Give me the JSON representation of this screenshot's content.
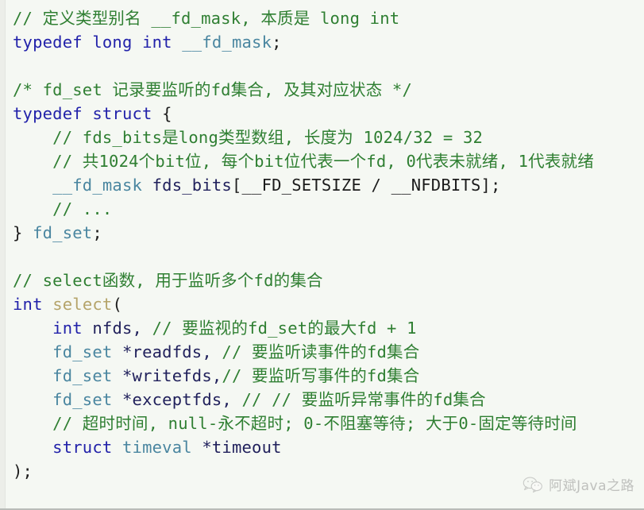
{
  "theme": {
    "background": "#f5f8f3",
    "gutter": "#eceee9",
    "comment_color": "#2f7f32",
    "keyword_color": "#2222aa",
    "type_color": "#4a86a0",
    "function_color": "#b5a46a",
    "identifier_color": "#21215c",
    "punctuation_color": "#1c1c1c"
  },
  "code": {
    "language": "c",
    "lines": [
      {
        "id": "l1",
        "text": "// 定义类型别名 __fd_mask, 本质是 long int"
      },
      {
        "id": "l2a",
        "text": "typedef"
      },
      {
        "id": "l2b",
        "text": "long"
      },
      {
        "id": "l2c",
        "text": "int"
      },
      {
        "id": "l2d",
        "text": "__fd_mask"
      },
      {
        "id": "l2e",
        "text": ";"
      },
      {
        "id": "l4",
        "text": "/* fd_set 记录要监听的fd集合, 及其对应状态 */"
      },
      {
        "id": "l5a",
        "text": "typedef"
      },
      {
        "id": "l5b",
        "text": "struct"
      },
      {
        "id": "l5c",
        "text": "{"
      },
      {
        "id": "l6",
        "text": "// fds_bits是long类型数组, 长度为 1024/32 = 32"
      },
      {
        "id": "l7",
        "text": "// 共1024个bit位, 每个bit位代表一个fd, 0代表未就绪, 1代表就绪"
      },
      {
        "id": "l8a",
        "text": "__fd_mask"
      },
      {
        "id": "l8b",
        "text": "fds_bits"
      },
      {
        "id": "l8c",
        "text": "[__FD_SETSIZE / __NFDBITS];"
      },
      {
        "id": "l9",
        "text": "// ..."
      },
      {
        "id": "l10a",
        "text": "}"
      },
      {
        "id": "l10b",
        "text": "fd_set"
      },
      {
        "id": "l10c",
        "text": ";"
      },
      {
        "id": "l12",
        "text": "// select函数, 用于监听多个fd的集合"
      },
      {
        "id": "l13a",
        "text": "int"
      },
      {
        "id": "l13b",
        "text": "select"
      },
      {
        "id": "l13c",
        "text": "("
      },
      {
        "id": "l14a",
        "text": "int"
      },
      {
        "id": "l14b",
        "text": "nfds,"
      },
      {
        "id": "l14c",
        "text": "// 要监视的fd_set的最大fd + 1"
      },
      {
        "id": "l15a",
        "text": "fd_set"
      },
      {
        "id": "l15b",
        "text": "*readfds,"
      },
      {
        "id": "l15c",
        "text": "// 要监听读事件的fd集合"
      },
      {
        "id": "l16a",
        "text": "fd_set"
      },
      {
        "id": "l16b",
        "text": "*writefds,"
      },
      {
        "id": "l16c",
        "text": "// 要监听写事件的fd集合"
      },
      {
        "id": "l17a",
        "text": "fd_set"
      },
      {
        "id": "l17b",
        "text": "*exceptfds,"
      },
      {
        "id": "l17c",
        "text": "// // 要监听异常事件的fd集合"
      },
      {
        "id": "l18",
        "text": "// 超时时间, null-永不超时; 0-不阻塞等待; 大于0-固定等待时间"
      },
      {
        "id": "l19a",
        "text": "struct"
      },
      {
        "id": "l19b",
        "text": "timeval"
      },
      {
        "id": "l19c",
        "text": "*timeout"
      },
      {
        "id": "l20",
        "text": ");"
      }
    ]
  },
  "watermark": {
    "icon": "wechat-icon",
    "text": "阿斌Java之路"
  }
}
